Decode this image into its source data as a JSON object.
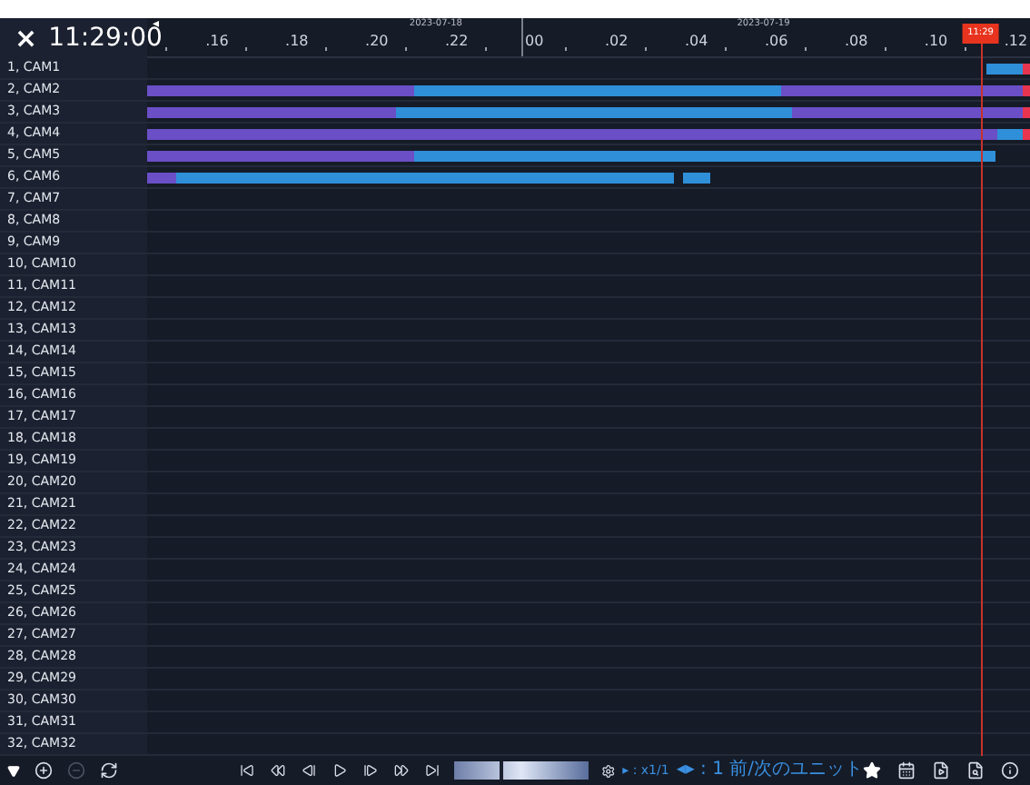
{
  "header": {
    "close": "×",
    "clock": "11:29:00",
    "scroll_left": "◂"
  },
  "timeline": {
    "dates": [
      "2023-07-18",
      "2023-07-19"
    ],
    "ticks": [
      {
        "label": ".16",
        "day_start": false
      },
      {
        "label": ".18",
        "day_start": false
      },
      {
        "label": ".20",
        "day_start": false
      },
      {
        "label": ".22",
        "day_start": false
      },
      {
        "label": "00",
        "day_start": true
      },
      {
        "label": ".02",
        "day_start": false
      },
      {
        "label": ".04",
        "day_start": false
      },
      {
        "label": ".06",
        "day_start": false
      },
      {
        "label": ".08",
        "day_start": false
      },
      {
        "label": ".10",
        "day_start": false
      },
      {
        "label": ".12",
        "day_start": false
      }
    ],
    "marker": {
      "label": "11:29",
      "level": 0.944
    }
  },
  "cameras": [
    {
      "name": "1, CAM1"
    },
    {
      "name": "2, CAM2"
    },
    {
      "name": "3, CAM3"
    },
    {
      "name": "4, CAM4"
    },
    {
      "name": "5, CAM5"
    },
    {
      "name": "6, CAM6"
    },
    {
      "name": "7, CAM7"
    },
    {
      "name": "8, CAM8"
    },
    {
      "name": "9, CAM9"
    },
    {
      "name": "10, CAM10"
    },
    {
      "name": "11, CAM11"
    },
    {
      "name": "12, CAM12"
    },
    {
      "name": "13, CAM13"
    },
    {
      "name": "14, CAM14"
    },
    {
      "name": "15, CAM15"
    },
    {
      "name": "16, CAM16"
    },
    {
      "name": "17, CAM17"
    },
    {
      "name": "18, CAM18"
    },
    {
      "name": "19, CAM19"
    },
    {
      "name": "20, CAM20"
    },
    {
      "name": "21, CAM21"
    },
    {
      "name": "22, CAM22"
    },
    {
      "name": "23, CAM23"
    },
    {
      "name": "24, CAM24"
    },
    {
      "name": "25, CAM25"
    },
    {
      "name": "26, CAM26"
    },
    {
      "name": "27, CAM27"
    },
    {
      "name": "28, CAM28"
    },
    {
      "name": "29, CAM29"
    },
    {
      "name": "30, CAM30"
    },
    {
      "name": "31, CAM31"
    },
    {
      "name": "32, CAM32"
    }
  ],
  "toolbar": {
    "zoom_out_disabled": true,
    "speed_slider": {
      "level": 0.34
    },
    "speed_text": "▸ : x1/1",
    "unit_text": "◂▸ : 1 前/次のユニット"
  }
}
